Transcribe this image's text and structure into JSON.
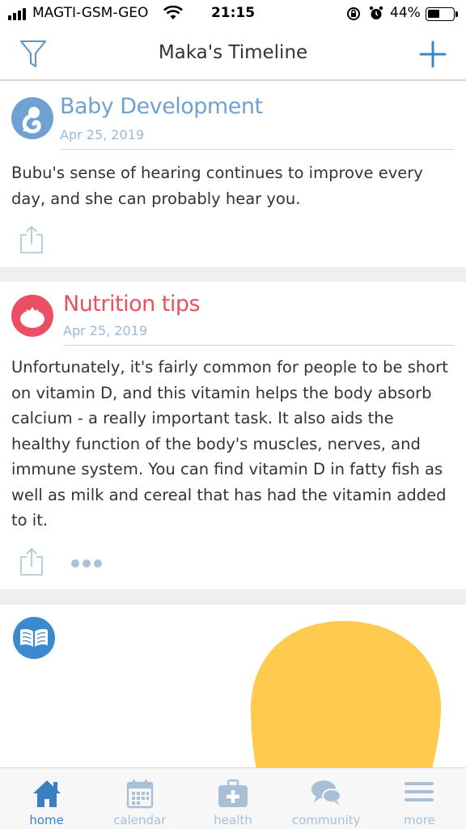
{
  "status_bar": {
    "carrier": "MAGTI-GSM-GEO",
    "time": "21:15",
    "battery": "44%"
  },
  "nav": {
    "title": "Maka's Timeline",
    "filter_icon": "filter-icon",
    "add_icon": "plus-icon"
  },
  "cards": [
    {
      "title": "Baby Development",
      "date": "Apr 25, 2019",
      "body": "Bubu's sense of hearing continues to improve every day, and she can probably hear you.",
      "icon": "fetus-icon",
      "color": "#6fa1d1"
    },
    {
      "title": "Nutrition tips",
      "date": "Apr 25, 2019",
      "body": "Unfortunately, it's fairly common for people to be short on vitamin D, and this vitamin helps the body absorb calcium - a really important task. It also aids the healthy function of the body's muscles, nerves, and immune system. You can find vitamin D in fatty fish as well as milk and cereal that has had the vitamin added to it.",
      "icon": "tomato-icon",
      "color": "#ea4f64"
    },
    {
      "icon": "book-icon",
      "color": "#3a8ad0"
    }
  ],
  "tabs": [
    {
      "label": "home",
      "icon": "home-icon",
      "active": true
    },
    {
      "label": "calendar",
      "icon": "calendar-icon"
    },
    {
      "label": "health",
      "icon": "medkit-icon"
    },
    {
      "label": "community",
      "icon": "chat-icon"
    },
    {
      "label": "more",
      "icon": "menu-icon"
    }
  ],
  "colors": {
    "accent": "#3a7fc4",
    "inactive": "#a8c0d6",
    "development": "#6fa1d1",
    "nutrition": "#ea4f64",
    "illustration": "#fecb4e"
  }
}
